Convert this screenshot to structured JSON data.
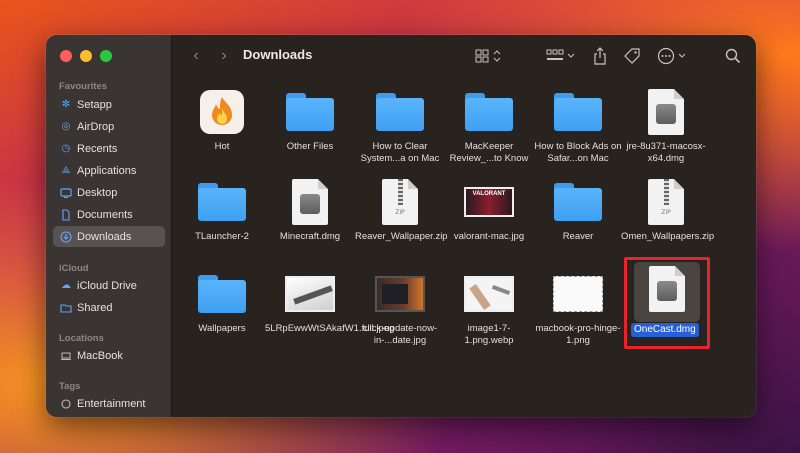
{
  "window": {
    "title": "Downloads"
  },
  "sidebar": {
    "favourites_heading": "Favourites",
    "favourites": [
      {
        "label": "Setapp",
        "icon": "setapp-icon"
      },
      {
        "label": "AirDrop",
        "icon": "airdrop-icon"
      },
      {
        "label": "Recents",
        "icon": "clock-icon"
      },
      {
        "label": "Applications",
        "icon": "applications-icon"
      },
      {
        "label": "Desktop",
        "icon": "desktop-icon"
      },
      {
        "label": "Documents",
        "icon": "document-icon"
      },
      {
        "label": "Downloads",
        "icon": "download-icon",
        "selected": true
      }
    ],
    "icloud_heading": "iCloud",
    "icloud": [
      {
        "label": "iCloud Drive",
        "icon": "cloud-icon"
      },
      {
        "label": "Shared",
        "icon": "shared-folder-icon"
      }
    ],
    "locations_heading": "Locations",
    "locations": [
      {
        "label": "MacBook",
        "icon": "laptop-icon"
      }
    ],
    "tags_heading": "Tags",
    "tags": [
      {
        "label": "Entertainment",
        "icon": "tag-circle-icon"
      }
    ]
  },
  "files": [
    {
      "name": "Hot",
      "kind": "app"
    },
    {
      "name": "Other Files",
      "kind": "folder"
    },
    {
      "name": "How to Clear System...a on Mac",
      "kind": "folder"
    },
    {
      "name": "MacKeeper Review_...to Know",
      "kind": "folder"
    },
    {
      "name": "How to Block Ads on Safar...on Mac",
      "kind": "folder"
    },
    {
      "name": "jre-8u371-macosx-x64.dmg",
      "kind": "dmg"
    },
    {
      "name": "TLauncher-2",
      "kind": "folder"
    },
    {
      "name": "Minecraft.dmg",
      "kind": "dmg"
    },
    {
      "name": "Reaver_Wallpaper.zip",
      "kind": "zip"
    },
    {
      "name": "valorant-mac.jpg",
      "kind": "image"
    },
    {
      "name": "Reaver",
      "kind": "folder"
    },
    {
      "name": "Omen_Wallpapers.zip",
      "kind": "zip"
    },
    {
      "name": "Wallpapers",
      "kind": "folder"
    },
    {
      "name": "5LRpEwwWtSAkafW1.full.jpeg",
      "kind": "image"
    },
    {
      "name": "click-update-now-in-...date.jpg",
      "kind": "image"
    },
    {
      "name": "image1-7-1.png.webp",
      "kind": "image"
    },
    {
      "name": "macbook-pro-hinge-1.png",
      "kind": "image"
    },
    {
      "name": "OneCast.dmg",
      "kind": "dmg",
      "selected": true
    }
  ],
  "zip_badge": "ZIP",
  "valorant_badge": "VALORANT",
  "colors": {
    "folder": "#3ea0f2",
    "selection": "#2760d6",
    "highlight_box": "#e8232d"
  }
}
